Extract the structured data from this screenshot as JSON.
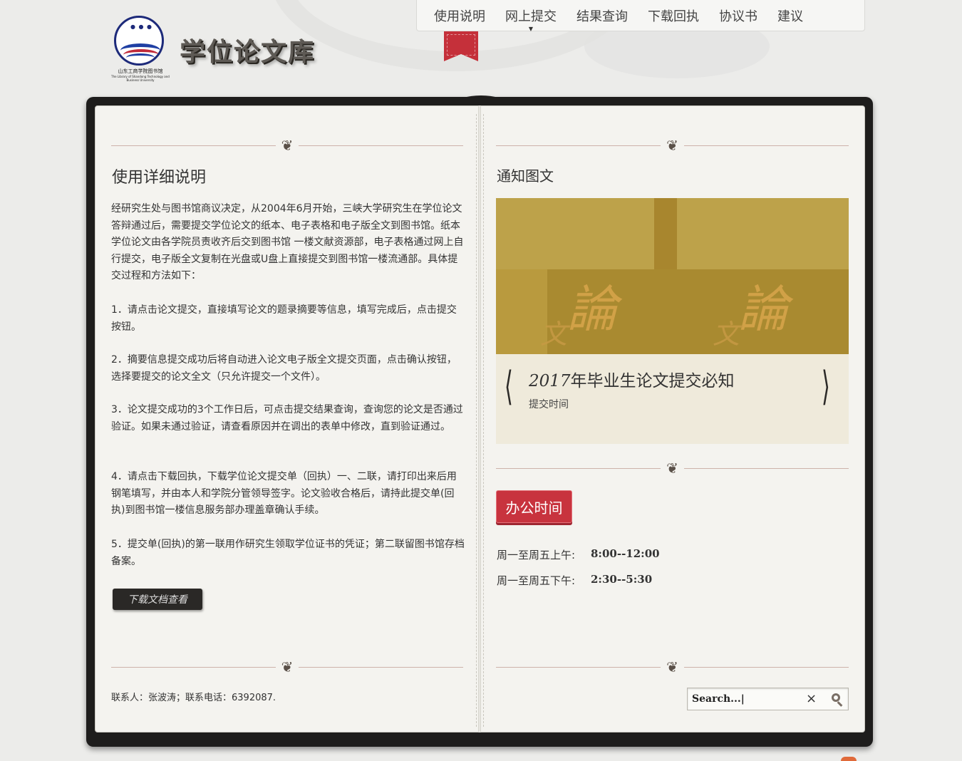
{
  "header": {
    "logo_caption_cn": "山东工商学院图书馆",
    "logo_caption_en": "The Library of Shandong Technology and Business University",
    "site_title": "学位论文库"
  },
  "nav": {
    "items": [
      {
        "label": "使用说明"
      },
      {
        "label": "网上提交"
      },
      {
        "label": "结果查询"
      },
      {
        "label": "下载回执"
      },
      {
        "label": "协议书"
      },
      {
        "label": "建议"
      }
    ],
    "active_index": 1
  },
  "left_page": {
    "heading": "使用详细说明",
    "intro": "经研究生处与图书馆商议决定，从2004年6月开始，三峡大学研究生在学位论文答辩通过后，需要提交学位论文的纸本、电子表格和电子版全文到图书馆。纸本学位论文由各学院员责收齐后交到图书馆 一楼文献资源部，电子表格通过网上自行提交，电子版全文复制在光盘或U盘上直接提交到图书馆一楼流通部。具体提交过程和方法如下：",
    "steps": [
      "1．请点击论文提交，直接填写论文的题录摘要等信息，填写完成后，点击提交按钮。",
      "2．摘要信息提交成功后将自动进入论文电子版全文提交页面，点击确认按钮，选择要提交的论文全文（只允许提交一个文件）。",
      "3．论文提交成功的3个工作日后，可点击提交结果查询，查询您的论文是否通过验证。如果未通过验证，请查看原因并在调出的表单中修改，直到验证通过。",
      "4．请点击下载回执，下载学位论文提交单（回执）一、二联，请打印出来后用钢笔填写，并由本人和学院分管领导签字。论文验收合格后，请持此提交单(回执)到图书馆一楼信息服务部办理盖章确认手续。",
      "5．提交单(回执)的第一联用作研究生领取学位证书的凭证；第二联留图书馆存档备案。"
    ],
    "download_button": "下载文档查看",
    "contact": "联系人：张波涛；联系电话：6392087."
  },
  "right_page": {
    "heading": "通知图文",
    "slider": {
      "title_year": "2017",
      "title_rest": "年毕业生论文提交必知",
      "subtitle": "提交时间",
      "prev_glyph": "⟨",
      "next_glyph": "⟩"
    },
    "office_hours": {
      "button": "办公时间",
      "rows": [
        {
          "label": "周一至周五上午:",
          "value": "8:00--12:00"
        },
        {
          "label": "周一至周五下午:",
          "value": "2:30--5:30"
        }
      ]
    },
    "search": {
      "placeholder": "Search...",
      "value": "Search...|"
    }
  },
  "ornament_glyph": "❦",
  "colors": {
    "accent_red": "#c8333e",
    "book_border": "#1e1d1c",
    "page_bg": "#f4f3ef",
    "slide_gold": "#b99a3e"
  },
  "icons": [
    "search-icon",
    "close-icon",
    "chevron-left-icon",
    "chevron-right-icon",
    "bookmark-ribbon-icon",
    "ornament-icon"
  ]
}
